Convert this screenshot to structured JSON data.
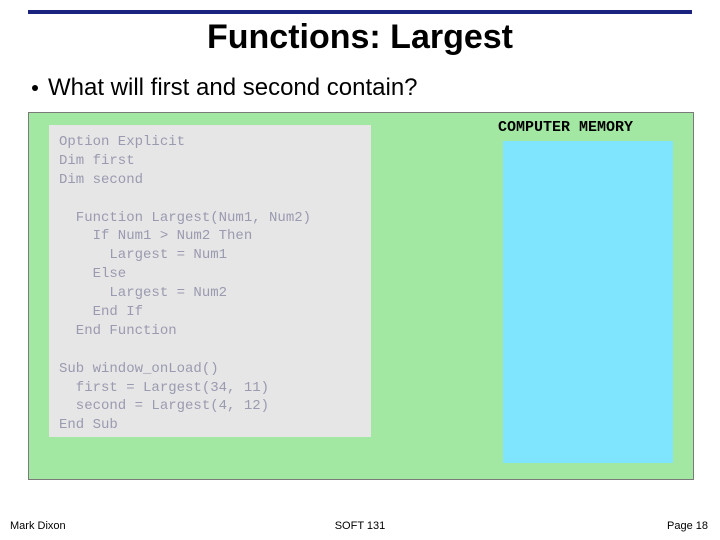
{
  "title": "Functions: Largest",
  "bullet": "What will first and second contain?",
  "memory_label": "COMPUTER MEMORY",
  "code": "Option Explicit\nDim first\nDim second\n\n  Function Largest(Num1, Num2)\n    If Num1 > Num2 Then\n      Largest = Num1\n    Else\n      Largest = Num2\n    End If\n  End Function\n\nSub window_onLoad()\n  first = Largest(34, 11)\n  second = Largest(4, 12)\nEnd Sub",
  "footer": {
    "left": "Mark Dixon",
    "center": "SOFT 131",
    "right": "Page 18"
  }
}
